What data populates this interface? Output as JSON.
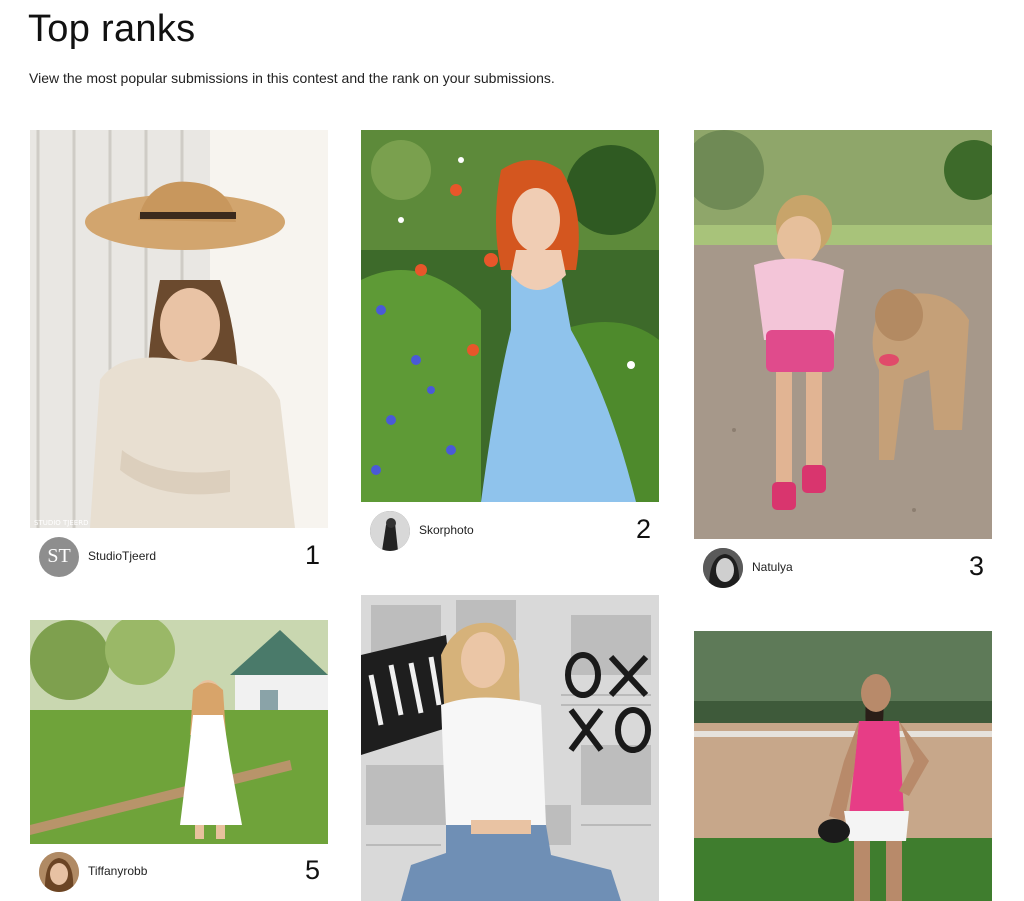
{
  "page": {
    "title": "Top ranks",
    "subtitle": "View the most popular submissions in this contest and the rank on your submissions."
  },
  "entries": [
    {
      "user": "StudioTjeerd",
      "rank": "1",
      "avatar_initials": "ST",
      "watermark": "STUDIO TJEERD",
      "subject": "girl-in-straw-hat-photo"
    },
    {
      "user": "Skorphoto",
      "rank": "2",
      "subject": "red-haired-woman-in-flower-field-photo"
    },
    {
      "user": "Natulya",
      "rank": "3",
      "subject": "girl-petting-dog-photo"
    },
    {
      "user": "Tiffanyrobb",
      "rank": "5",
      "subject": "girl-in-white-dress-garden-photo"
    },
    {
      "user": "",
      "rank": "",
      "subject": "woman-with-newspaper-backdrop-photo"
    },
    {
      "user": "",
      "rank": "",
      "subject": "girl-softball-player-photo"
    }
  ],
  "colors": {
    "background": "#ffffff",
    "text": "#111111"
  }
}
